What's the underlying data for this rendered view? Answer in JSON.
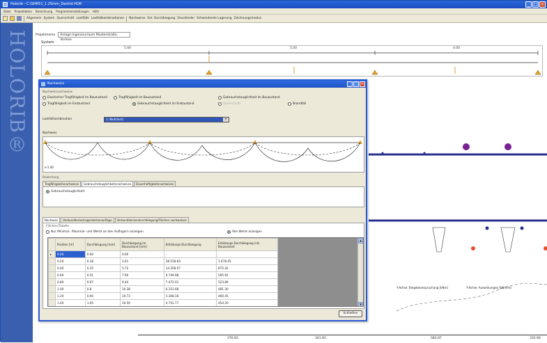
{
  "app": {
    "title": "Holorib - C:\\SHR51_1.25mm_Deckid.HOR",
    "logo_text": "HOLORIB®"
  },
  "menubar": [
    "Datei",
    "Projektdaten",
    "Berechnung",
    "Programmeinstellungen",
    "Hilfe"
  ],
  "toolbar": [
    "Allgemein",
    "System",
    "Querschnitt",
    "Lastfälle",
    "Lastfallkombinationen",
    "Nachweise",
    "Ext. Durchbiegung",
    "Drucklieder",
    "Schwindende Lagerung",
    "Zeichnungsmodus"
  ],
  "project": {
    "label": "Projektname",
    "value": "Anlage Ingenieurraum Musterstraße, Vorlese"
  },
  "system": {
    "label": "System",
    "spans": [
      "5.00",
      "5.00",
      "4.00"
    ]
  },
  "dialog": {
    "title": "Nachweise",
    "group_label": "Nachweisnachweise",
    "radios": [
      {
        "label": "Elastischer Tragfähigkeit im Bauzustand",
        "checked": false,
        "disabled": false
      },
      {
        "label": "Tragfähigkeit im Bauzustand",
        "checked": false,
        "disabled": false
      },
      {
        "label": "Gebrauchstauglichkeit im Bauzustand",
        "checked": false,
        "disabled": false
      },
      {
        "label": "Tragfähigkeit im Endzustand",
        "checked": false,
        "disabled": false
      },
      {
        "label": "Gebrauchstauglichkeit im Endzustand",
        "checked": true,
        "disabled": false
      },
      {
        "label": "Querschnitt",
        "checked": false,
        "disabled": true
      },
      {
        "label": "Brandfall",
        "checked": false,
        "disabled": false
      }
    ],
    "loadcase_label": "Lastfallkombination",
    "loadcase_value": "1 (Nutzlast)",
    "nachweis_label": "Nachweis",
    "scale_label": "e-1.00",
    "bewertung_label": "Bewertung",
    "tabs_top": [
      "Tragfähigkeitsnachweise",
      "Gebrauchstauglichkeitsnachweise",
      "Dauerhaftigkeitsnachweise"
    ],
    "bewertung_radio": "Gebrauchstauglichkeit",
    "tabs_bottom": [
      "Nachweis",
      "Verbunddecke/Lagerdeckenauflage",
      "Verbunddeckendurchbiegung/Flächen nachweisen"
    ],
    "table_group_label": "Flächen/Tabelle",
    "table_radio_left": "Nur Minimal-, Maximal- und Werte an den Auflagern anzeigen",
    "table_radio_right": "Alle Werte anzeigen",
    "columns": [
      "Position [m]",
      "Durchbiegung [mm]",
      "Durchbiegung im Bauzustand [mm]",
      "Erbildungs-Durchbiegung",
      "Erbildungs-Durchbiegung inkl. Bauzustand"
    ],
    "rows": [
      [
        "0.00",
        "0.00",
        "0.00",
        "-",
        "-"
      ],
      [
        "0.20",
        "0.18",
        "3.01",
        "28.518.64",
        "1.678.45"
      ],
      [
        "0.40",
        "0.35",
        "5.72",
        "14.358.57",
        "872.42"
      ],
      [
        "0.60",
        "0.51",
        "7.90",
        "9.749.98",
        "595.92"
      ],
      [
        "0.80",
        "0.67",
        "9.44",
        "7.472.01",
        "523.89"
      ],
      [
        "1.00",
        "0.8",
        "10.38",
        "6.151.68",
        "481.30"
      ],
      [
        "1.20",
        "0.94",
        "10.73",
        "5.308.18",
        "460.45"
      ],
      [
        "1.40",
        "1.05",
        "10.50",
        "4.741.77",
        "454.20"
      ]
    ],
    "close_label": "Schließen"
  },
  "right_pane": {
    "axis_labels": [
      "Y-Achse: Biegebeanspruchung [kNm]",
      "Y-Achse: Auswirkungen [kNm/m]"
    ],
    "footer_ticks": [
      "370.93",
      "341.93",
      "583.97",
      "332.90"
    ]
  }
}
